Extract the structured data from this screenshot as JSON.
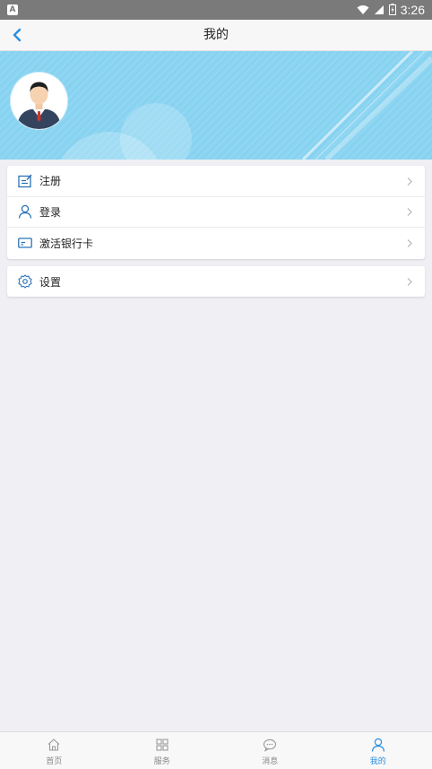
{
  "status_bar": {
    "notification_icon_text": "A",
    "time": "3:26"
  },
  "header": {
    "title": "我的",
    "back_icon": "chevron-left-icon"
  },
  "colors": {
    "accent": "#2b8fe0",
    "banner": "#87d2f0",
    "background": "#efeff4"
  },
  "menu": {
    "group1": [
      {
        "label": "注册",
        "icon": "edit-note-icon"
      },
      {
        "label": "登录",
        "icon": "user-icon"
      },
      {
        "label": "激活银行卡",
        "icon": "card-icon"
      }
    ],
    "group2": [
      {
        "label": "设置",
        "icon": "gear-icon"
      }
    ]
  },
  "tabs": [
    {
      "label": "首页",
      "icon": "home-icon",
      "active": false
    },
    {
      "label": "服务",
      "icon": "grid-icon",
      "active": false
    },
    {
      "label": "消息",
      "icon": "message-icon",
      "active": false
    },
    {
      "label": "我的",
      "icon": "user-icon",
      "active": true
    }
  ]
}
